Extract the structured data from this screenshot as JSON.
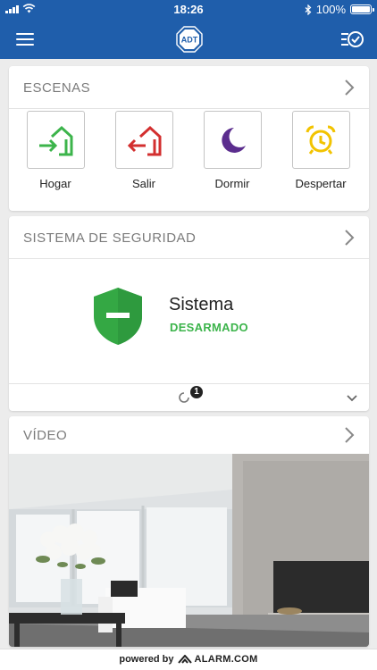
{
  "status_bar": {
    "time": "18:26",
    "battery": "100%",
    "battery_level": 1.0
  },
  "app_bar": {
    "logo_text": "ADT",
    "brand_color": "#1f5eab"
  },
  "scenes": {
    "title": "ESCENAS",
    "items": [
      {
        "label": "Hogar",
        "icon": "home-enter-icon",
        "color": "#3cb44b"
      },
      {
        "label": "Salir",
        "icon": "home-exit-icon",
        "color": "#d32f2f"
      },
      {
        "label": "Dormir",
        "icon": "moon-icon",
        "color": "#5b2d8e"
      },
      {
        "label": "Despertar",
        "icon": "alarm-clock-icon",
        "color": "#f2c300"
      }
    ]
  },
  "security": {
    "title": "SISTEMA DE SEGURIDAD",
    "system_name": "Sistema",
    "system_state": "DESARMADO",
    "state_color": "#3cb44b",
    "pending_count": "1"
  },
  "video": {
    "title": "VÍDEO"
  },
  "footer": {
    "powered_by": "powered by",
    "partner": "ALARM.COM"
  }
}
